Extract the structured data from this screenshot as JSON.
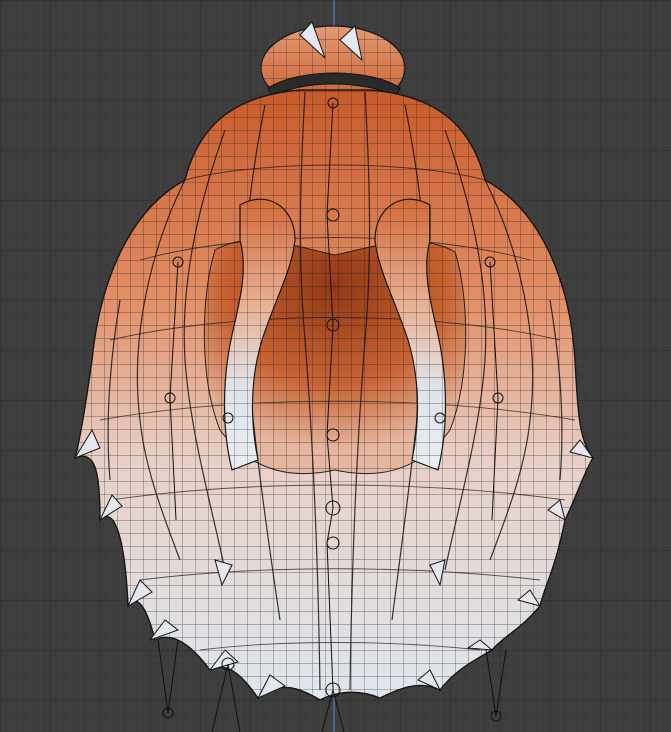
{
  "viewport": {
    "background": "#3d3d3d",
    "grid_minor_color": "#474747",
    "grid_major_color": "#2f2f2f",
    "axis_color": "#4d7fc2"
  },
  "model": {
    "hair_top_color": "#c85a2a",
    "hair_mid_color": "#e7a27f",
    "hair_bottom_color": "#dfe7ef",
    "hair_shadow_color": "#7a2d10",
    "wire_color": "#161616",
    "band_color": "#2a2a2a",
    "bone_color": "#111111"
  }
}
